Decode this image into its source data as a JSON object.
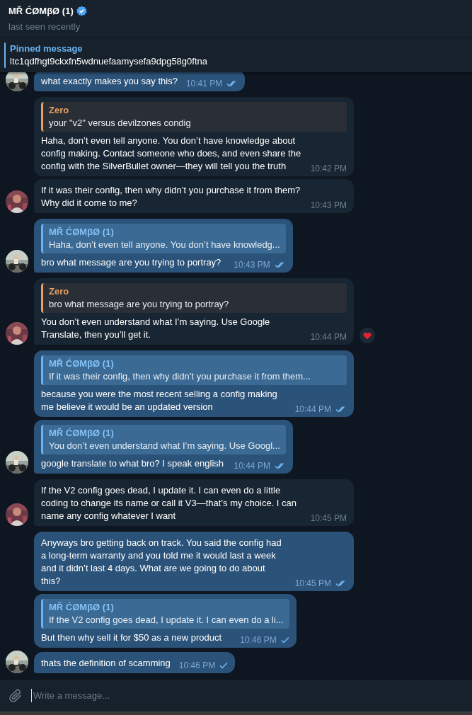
{
  "header": {
    "title": "MŘ ĆØMβØ (1)",
    "verified": true,
    "status": "last seen recently"
  },
  "pinned": {
    "label": "Pinned message",
    "text": "ltc1qdfhgt9ckxfn5wdnuefaamysefa9dpg58g0ftna"
  },
  "messages": [
    {
      "kind": "outgoing",
      "text": "what exactly makes you say this?",
      "time": "10:41 PM",
      "read": true,
      "avatar": true
    },
    {
      "kind": "incoming",
      "reply": {
        "author": "Zero",
        "text": "your \"v2\" versus devilzones condig"
      },
      "text": "Haha, don’t even tell anyone. You don’t have knowledge about config making. Contact someone who does, and even share the config with the SilverBullet owner—they will tell you the truth",
      "time": "10:42 PM",
      "avatar": false
    },
    {
      "kind": "incoming",
      "text": "If it was their config, then why didn’t you purchase it from them? Why did it come to me?",
      "time": "10:43 PM",
      "avatar": true
    },
    {
      "kind": "outgoing",
      "reply": {
        "author": "MŘ ĆØMβØ (1)",
        "text": "Haha, don’t even tell anyone. You don’t have knowledg..."
      },
      "text": "bro what message are you trying to portray?",
      "time": "10:43 PM",
      "read": true,
      "avatar": true
    },
    {
      "kind": "incoming",
      "reply": {
        "author": "Zero",
        "text": "bro what message are you trying to portray?"
      },
      "text": "You don’t even understand what I’m saying. Use Google Translate, then you’ll get it.",
      "time": "10:44 PM",
      "avatar": true,
      "hearted": true
    },
    {
      "kind": "outgoing",
      "reply": {
        "author": "MŘ ĆØMβØ (1)",
        "text": "If it was their config, then why didn’t you purchase it from them..."
      },
      "text": "because you were the most recent selling a config making me believe it would be an updated version",
      "time": "10:44 PM",
      "read": true,
      "avatar": false
    },
    {
      "kind": "outgoing",
      "reply": {
        "author": "MŘ ĆØMβØ (1)",
        "text": "You don’t even understand what I’m saying. Use Googl..."
      },
      "text": "google translate to what bro? I speak english",
      "time": "10:44 PM",
      "read": true,
      "avatar": true
    },
    {
      "kind": "incoming",
      "text": "If the V2 config goes dead, I update it. I can even do a little coding to change its name or call it V3—that’s my choice. I can name any config whatever I want",
      "time": "10:45 PM",
      "avatar": true
    },
    {
      "kind": "outgoing",
      "text": "Anyways bro getting back on track. You said the config had a long-term warranty and you told me it would last a week and it didn’t last 4 days. What are we going to do about this?",
      "time": "10:45 PM",
      "read": true,
      "avatar": false
    },
    {
      "kind": "outgoing",
      "reply": {
        "author": "MŘ ĆØMβØ (1)",
        "text": "If the V2 config goes dead, I update it. I can even do a li..."
      },
      "text": "But then why sell it for $50 as a new product",
      "time": "10:46 PM",
      "read": false,
      "avatar": false
    },
    {
      "kind": "outgoing",
      "text": "thats the definition of scamming",
      "time": "10:46 PM",
      "read": false,
      "avatar": true
    }
  ],
  "composer": {
    "placeholder": "Write a message..."
  }
}
